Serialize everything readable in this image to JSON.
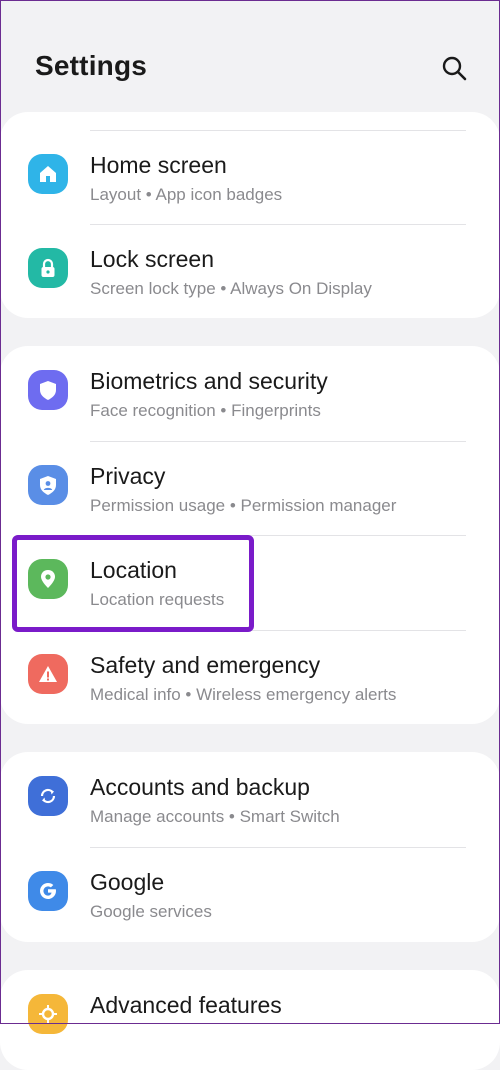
{
  "header": {
    "title": "Settings",
    "search_icon": "search-icon"
  },
  "groups": [
    {
      "items": [
        {
          "label": "Home screen",
          "sub": "Layout  •  App icon badges",
          "icon": "home-icon",
          "color": "#2fb4e8"
        },
        {
          "label": "Lock screen",
          "sub": "Screen lock type  •  Always On Display",
          "icon": "lock-icon",
          "color": "#23b9a5"
        }
      ]
    },
    {
      "items": [
        {
          "label": "Biometrics and security",
          "sub": "Face recognition  •  Fingerprints",
          "icon": "shield-icon",
          "color": "#6e6cf0"
        },
        {
          "label": "Privacy",
          "sub": "Permission usage  •  Permission manager",
          "icon": "privacy-shield-icon",
          "color": "#5a8ee6"
        },
        {
          "label": "Location",
          "sub": "Location requests",
          "icon": "location-pin-icon",
          "color": "#5cb85c"
        },
        {
          "label": "Safety and emergency",
          "sub": "Medical info  •  Wireless emergency alerts",
          "icon": "alert-icon",
          "color": "#ef6a5f"
        }
      ]
    },
    {
      "items": [
        {
          "label": "Accounts and backup",
          "sub": "Manage accounts  •  Smart Switch",
          "icon": "sync-icon",
          "color": "#3f6fd8"
        },
        {
          "label": "Google",
          "sub": "Google services",
          "icon": "google-icon",
          "color": "#3f8ae8"
        }
      ]
    },
    {
      "items": [
        {
          "label": "Advanced features",
          "sub": "",
          "icon": "advanced-features-icon",
          "color": "#f5b739"
        }
      ]
    }
  ],
  "highlight_color": "#7a1bc9"
}
